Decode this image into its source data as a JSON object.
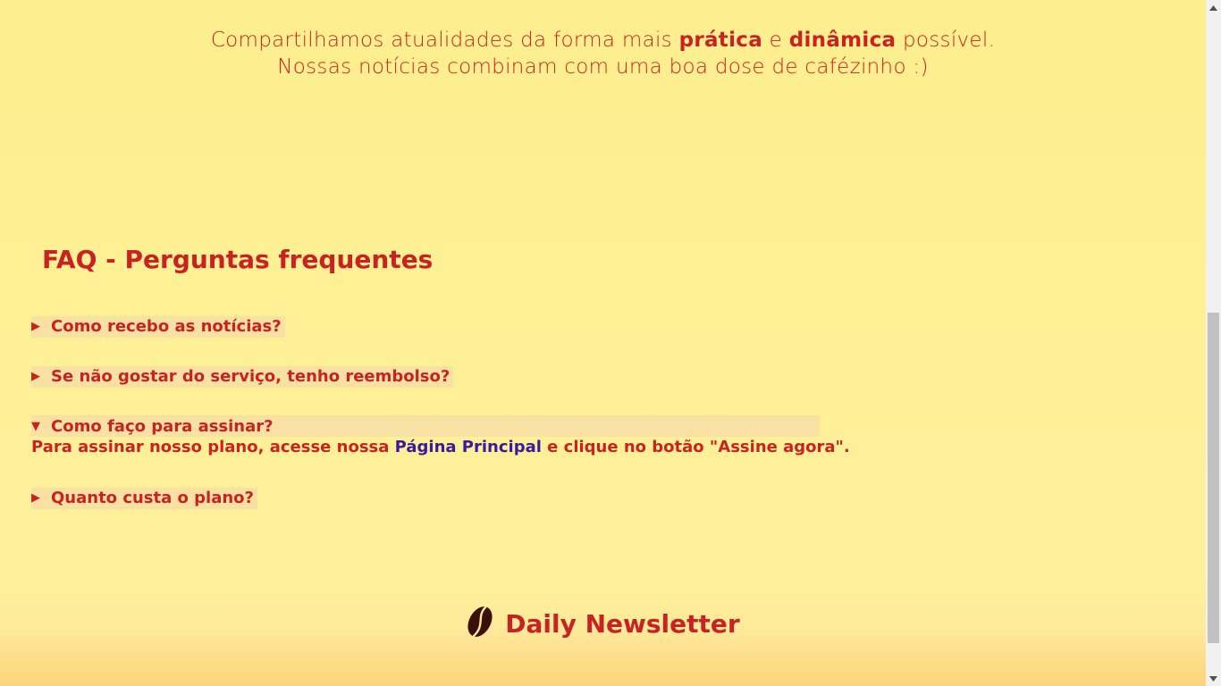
{
  "intro": {
    "line1_a": "Compartilhamos atualidades da forma mais ",
    "line1_b": "prática",
    "line1_c": " e ",
    "line1_d": "dinâmica",
    "line1_e": " possível.",
    "line2": "Nossas notícias combinam com uma boa dose de cafézinho :)"
  },
  "faq": {
    "title": "FAQ - Perguntas frequentes",
    "items": [
      {
        "question": "Como recebo as notícias?",
        "open": false
      },
      {
        "question": "Se não gostar do serviço, tenho reembolso?",
        "open": false
      },
      {
        "question": "Como faço para assinar?",
        "open": true,
        "answer_a": "Para assinar nosso plano, acesse nossa ",
        "answer_link": "Página Principal",
        "answer_b": " e clique no botão \"Assine agora\"."
      },
      {
        "question": "Quanto custa o plano?",
        "open": false
      }
    ],
    "closed_marker": "▶",
    "open_marker": "▼"
  },
  "footer": {
    "brand": "Daily Newsletter",
    "logo_icon": "coffee-bean-icon"
  },
  "colors": {
    "accent": "#c92222",
    "link": "#3a1a9e",
    "background": "#fdee90"
  }
}
